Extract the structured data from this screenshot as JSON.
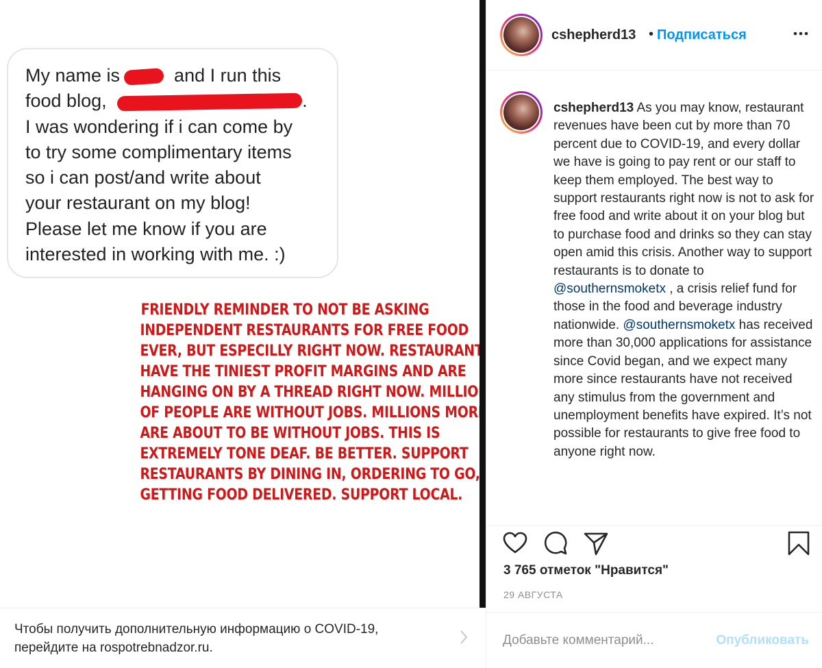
{
  "image": {
    "dm_lines": [
      {
        "before": "My name is ",
        "after": " and I run this"
      },
      {
        "before": "food blog, ",
        "after": "."
      },
      {
        "before": "I was wondering if i can come by",
        "after": ""
      },
      {
        "before": "to try some complimentary items",
        "after": ""
      },
      {
        "before": "so i can post/and write about",
        "after": ""
      },
      {
        "before": "your restaurant on my blog!",
        "after": ""
      },
      {
        "before": "Please let me know if you are",
        "after": ""
      },
      {
        "before": "interested in working with me. :)",
        "after": ""
      }
    ],
    "reminder_lines": [
      "FRIENDLY REMINDER TO NOT BE ASKING",
      "INDEPENDENT RESTAURANTS FOR FREE FOOD",
      "EVER, BUT ESPECILLY RIGHT NOW. RESTAURANTS",
      "HAVE THE TINIEST PROFIT MARGINS AND ARE",
      "HANGING ON BY A THREAD RIGHT NOW. MILLIONS",
      "OF PEOPLE ARE WITHOUT JOBS. MILLIONS MORE",
      "ARE ABOUT TO BE WITHOUT JOBS. THIS IS",
      "EXTREMELY TONE DEAF. BE BETTER. SUPPORT",
      "RESTAURANTS BY DINING IN, ORDERING TO GO, OR",
      "GETTING FOOD DELIVERED. SUPPORT LOCAL."
    ]
  },
  "covid_banner": {
    "text": "Чтобы получить дополнительную информацию о COVID-19, перейдите на rospotrebnadzor.ru."
  },
  "header": {
    "username": "cshepherd13",
    "dot": "•",
    "follow_label": "Подписаться"
  },
  "caption": {
    "username": "cshepherd13",
    "part1": " As you may know, restaurant revenues have been cut by more than 70 percent due to COVID-19, and every dollar we have is going to pay rent or our staff to keep them employed. The best way to support restaurants right now is not to ask for free food and write about it on your blog but to purchase food and drinks so they can stay open amid this crisis. Another way to support restaurants is to donate to ",
    "mention1": "@southernsmoketx",
    "part2": " , a crisis relief fund for those in the food and beverage industry nationwide. ",
    "mention2": "@southernsmoketx",
    "part3": " has received more than 30,000 applications for assistance since Covid began, and we expect many more since restaurants have not received any stimulus from the government and unemployment benefits have expired. It’s not possible for restaurants to give free food to anyone right now."
  },
  "stats": {
    "likes": "3 765 отметок \"Нравится\"",
    "date": "29 АВГУСТА"
  },
  "comment": {
    "placeholder": "Добавьте комментарий...",
    "publish_label": "Опубликовать"
  },
  "colors": {
    "follow": "#0095f6",
    "mention": "#00376b",
    "reminder_red": "#d01818",
    "redaction": "#e8131d",
    "publish_disabled": "#b2dffc"
  },
  "icons": [
    "heart-icon",
    "comment-icon",
    "share-icon",
    "bookmark-icon",
    "more-icon",
    "chevron-right-icon"
  ]
}
